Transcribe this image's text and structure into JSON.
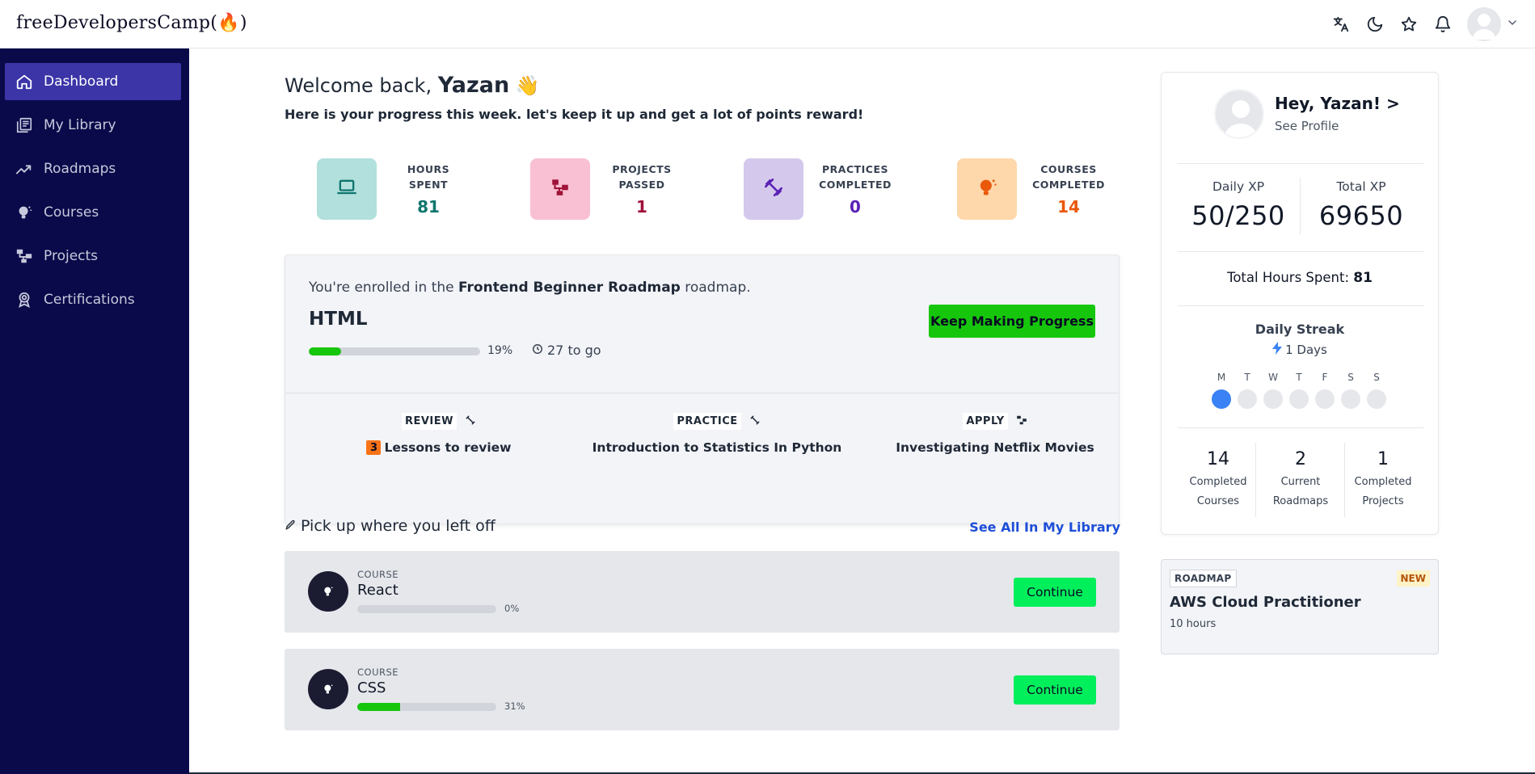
{
  "brand": {
    "logo_text": "freeDevelopersCamp(🔥)"
  },
  "topbar": {
    "icons": [
      "translate-icon",
      "moon-icon",
      "star-icon",
      "bell-icon",
      "avatar",
      "chevron-down-icon"
    ]
  },
  "sidebar": {
    "items": [
      {
        "label": "Dashboard",
        "icon": "home-icon",
        "active": true
      },
      {
        "label": "My Library",
        "icon": "library-icon",
        "active": false
      },
      {
        "label": "Roadmaps",
        "icon": "trend-icon",
        "active": false
      },
      {
        "label": "Courses",
        "icon": "lightbulb-icon",
        "active": false
      },
      {
        "label": "Projects",
        "icon": "flowchart-icon",
        "active": false
      },
      {
        "label": "Certifications",
        "icon": "award-icon",
        "active": false
      }
    ]
  },
  "header": {
    "welcome_prefix": "Welcome back,",
    "user_name": "Yazan",
    "wave": "👋",
    "subtitle": "Here is your progress this week. let's keep it up and get a lot of points reward!"
  },
  "stats": [
    {
      "label_1": "HOURS",
      "label_2": "SPENT",
      "value": "81",
      "color": "#0f766e",
      "bg": "#b2e0dc",
      "icon": "laptop-icon"
    },
    {
      "label_1": "PROJECTS",
      "label_2": "PASSED",
      "value": "1",
      "color": "#9f1239",
      "bg": "#f9c0d3",
      "icon": "flowchart-icon"
    },
    {
      "label_1": "PRACTICES",
      "label_2": "COMPLETED",
      "value": "0",
      "color": "#5b21b6",
      "bg": "#d4c8ec",
      "icon": "dumbbell-icon"
    },
    {
      "label_1": "COURSES",
      "label_2": "COMPLETED",
      "value": "14",
      "color": "#ea580c",
      "bg": "#fed7aa",
      "icon": "lightbulb-icon"
    }
  ],
  "roadmap": {
    "enrolled_prefix": "You're enrolled in the",
    "roadmap_name": "Frontend Beginner Roadmap",
    "enrolled_suffix": "roadmap.",
    "current_course": "HTML",
    "progress_percent": 19,
    "progress_label": "19%",
    "to_go": "27 to go",
    "button_label": "Keep Making Progress",
    "tasks": [
      {
        "tag": "REVIEW",
        "icon": "dumbbell-icon",
        "count": "3",
        "desc": "Lessons to review"
      },
      {
        "tag": "PRACTICE",
        "icon": "dumbbell-icon",
        "count": "",
        "desc": "Introduction to Statistics In Python"
      },
      {
        "tag": "APPLY",
        "icon": "flowchart-icon",
        "count": "",
        "desc": "Investigating Netflix Movies"
      }
    ]
  },
  "pickup": {
    "title": "Pick up where you left off",
    "see_all": "See All In My Library",
    "courses": [
      {
        "type": "COURSE",
        "name": "React",
        "percent": 0,
        "percent_label": "0%",
        "button": "Continue"
      },
      {
        "type": "COURSE",
        "name": "CSS",
        "percent": 31,
        "percent_label": "31%",
        "button": "Continue"
      }
    ]
  },
  "profile": {
    "greeting": "Hey, Yazan! >",
    "see_profile": "See Profile",
    "daily_xp_label": "Daily XP",
    "daily_xp_value": "50/250",
    "total_xp_label": "Total XP",
    "total_xp_value": "69650",
    "hours_label": "Total Hours Spent:",
    "hours_value": "81",
    "streak_title": "Daily Streak",
    "streak_days": "1 Days",
    "week_days": [
      {
        "letter": "M",
        "done": true
      },
      {
        "letter": "T",
        "done": false
      },
      {
        "letter": "W",
        "done": false
      },
      {
        "letter": "T",
        "done": false
      },
      {
        "letter": "F",
        "done": false
      },
      {
        "letter": "S",
        "done": false
      },
      {
        "letter": "S",
        "done": false
      }
    ],
    "summary": [
      {
        "value": "14",
        "label_1": "Completed",
        "label_2": "Courses"
      },
      {
        "value": "2",
        "label_1": "Current",
        "label_2": "Roadmaps"
      },
      {
        "value": "1",
        "label_1": "Completed",
        "label_2": "Projects"
      }
    ]
  },
  "promo": {
    "tag": "ROADMAP",
    "badge": "NEW",
    "title": "AWS Cloud Practitioner",
    "hours": "10 hours"
  },
  "colors": {
    "sidebar_bg": "#0a0a4a",
    "sidebar_active": "#3b35a8",
    "accent_green": "#16c60c",
    "continue_green": "#00ef5b",
    "link_blue": "#1d4ed8",
    "streak_blue": "#3b82f6"
  }
}
